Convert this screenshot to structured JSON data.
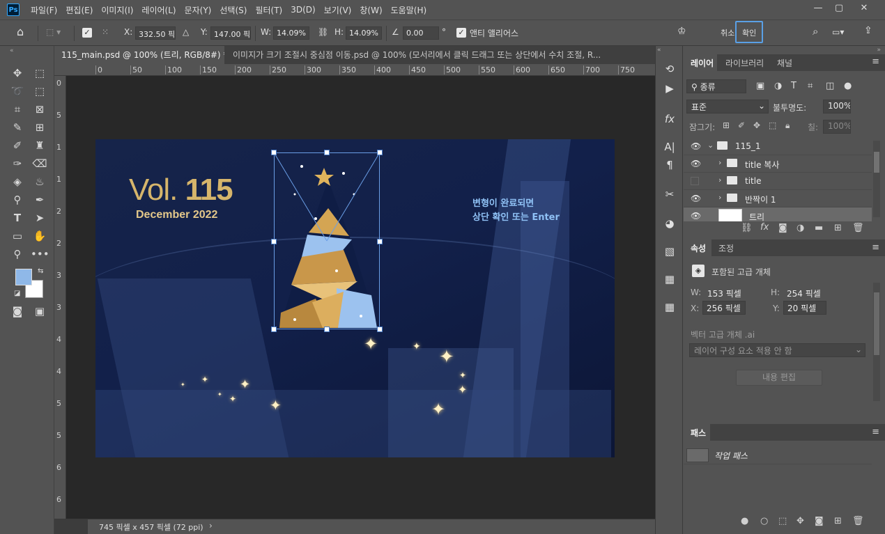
{
  "app": {
    "logo": "Ps"
  },
  "menu": [
    "파일(F)",
    "편집(E)",
    "이미지(I)",
    "레이어(L)",
    "문자(Y)",
    "선택(S)",
    "필터(T)",
    "3D(D)",
    "보기(V)",
    "창(W)",
    "도움말(H)"
  ],
  "window_controls": {
    "minimize": "—",
    "restore": "▢",
    "close": "✕"
  },
  "options": {
    "x_label": "X:",
    "x_value": "332.50 픽셀",
    "y_label": "Y:",
    "y_value": "147.00 픽셀",
    "w_label": "W:",
    "w_value": "14.09%",
    "h_label": "H:",
    "h_value": "14.09%",
    "angle_value": "0.00",
    "angle_unit": "°",
    "antialias_label": "앤티 앨리어스",
    "cancel_label": "취소",
    "confirm_label": "확인"
  },
  "tabs": [
    {
      "label": "115_main.psd @ 100% (트리, RGB/8#) *",
      "close": "×"
    },
    {
      "label": "이미지가 크기 조절시 중심점 이동.psd @ 100% (모서리에서 클릭 드래그 또는 상단에서 수치 조절, R...",
      "close": ""
    }
  ],
  "ruler_h": [
    "0",
    "50",
    "100",
    "150",
    "200",
    "250",
    "300",
    "350",
    "400",
    "450",
    "500",
    "550",
    "600",
    "650",
    "700",
    "750"
  ],
  "ruler_v": [
    "0",
    "5",
    "1",
    "1",
    "2",
    "2",
    "3",
    "3",
    "4",
    "4",
    "5",
    "5",
    "6",
    "6"
  ],
  "canvas": {
    "vol_prefix": "Vol.",
    "vol_number": "115",
    "date": "December 2022",
    "note_line1": "변형이 완료되면",
    "note_line2": "상단 확인 또는 Enter"
  },
  "status": {
    "text": "745 픽셀 x 457 픽셀 (72 ppi)",
    "arrow": "›"
  },
  "layers_panel": {
    "tabs": [
      "레이어",
      "라이브러리",
      "채널"
    ],
    "filter_label": "종류",
    "blend_mode": "표준",
    "opacity_label": "불투명도:",
    "opacity_value": "100%",
    "lock_label": "잠그기:",
    "fill_label": "칠:",
    "fill_value": "100%",
    "layers": [
      {
        "name": "115_1",
        "visible": true
      },
      {
        "name": "title 복사",
        "visible": true
      },
      {
        "name": "title",
        "visible": false
      },
      {
        "name": "반짝이 1",
        "visible": true
      },
      {
        "name": "트리",
        "visible": true
      }
    ]
  },
  "properties_panel": {
    "tabs": [
      "속성",
      "조정"
    ],
    "type_label": "포함된 고급 개체",
    "w_label": "W:",
    "w_value": "153 픽셀",
    "h_label": "H:",
    "h_value": "254 픽셀",
    "x_label": "X:",
    "x_value": "256 픽셀",
    "y_label": "Y:",
    "y_value": "20 픽셀",
    "source_file": "벡터 고급 개체 .ai",
    "comp_select": "레이어 구성 요소 적용 안 함",
    "edit_button": "내용 편집"
  },
  "paths_panel": {
    "tab": "패스",
    "items": [
      "작업 패스"
    ]
  },
  "colors": {
    "foreground": "#8fb8e8",
    "background": "#ffffff",
    "accent": "#4a90d9",
    "gold": "#c9a24e"
  }
}
